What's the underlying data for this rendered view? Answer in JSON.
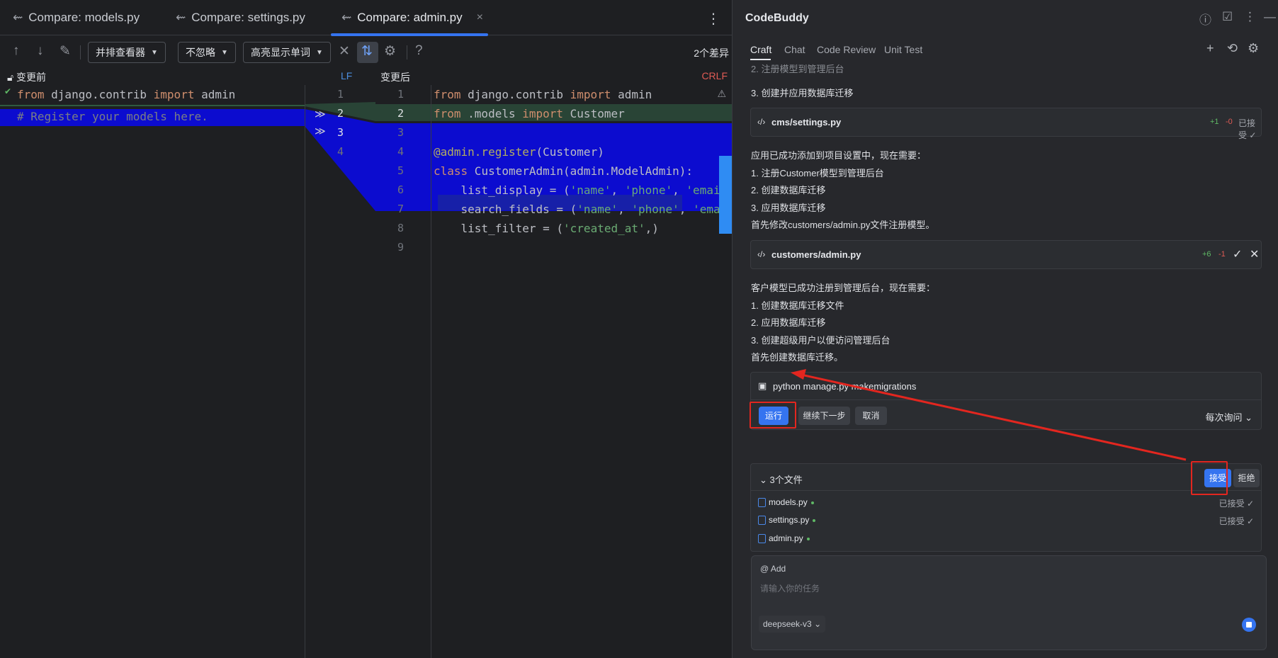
{
  "editor": {
    "tabs": [
      {
        "label": "Compare: models.py"
      },
      {
        "label": "Compare: settings.py"
      },
      {
        "label": "Compare: admin.py",
        "close": "×"
      }
    ],
    "more_label": "⋮",
    "toolbar": {
      "viewer_mode": "并排查看器",
      "ignore_mode": "不忽略",
      "highlight_mode": "高亮显示单词",
      "help_label": "?",
      "diff_count": "2个差异"
    },
    "before_label": "变更前",
    "before_eol": "LF",
    "after_label": "变更后",
    "after_eol": "CRLF",
    "left_lines": [
      {
        "num": "1",
        "tokens": [
          [
            "kw",
            "from"
          ],
          [
            "id",
            " django.contrib "
          ],
          [
            "kw",
            "import"
          ],
          [
            "id",
            " admin"
          ]
        ]
      },
      {
        "num": "2",
        "tokens": []
      },
      {
        "num": "3",
        "tokens": [
          [
            "com",
            "# Register your models here."
          ]
        ]
      },
      {
        "num": "4",
        "tokens": []
      }
    ],
    "right_lines": [
      {
        "num": "1",
        "tokens": [
          [
            "kw",
            "from"
          ],
          [
            "id",
            " django.contrib "
          ],
          [
            "kw",
            "import"
          ],
          [
            "id",
            " admin"
          ]
        ]
      },
      {
        "num": "2",
        "tokens": [
          [
            "kw",
            "from"
          ],
          [
            "id",
            " .models "
          ],
          [
            "kw",
            "import"
          ],
          [
            "id",
            " Customer"
          ]
        ]
      },
      {
        "num": "3",
        "tokens": []
      },
      {
        "num": "4",
        "tokens": [
          [
            "dec",
            "@admin.register"
          ],
          [
            "id",
            "(Customer)"
          ]
        ]
      },
      {
        "num": "5",
        "tokens": [
          [
            "kw",
            "class"
          ],
          [
            "id",
            " CustomerAdmin(admin.ModelAdmin):"
          ]
        ]
      },
      {
        "num": "6",
        "tokens": [
          [
            "id",
            "    list_display = ("
          ],
          [
            "str",
            "'name'"
          ],
          [
            "id",
            ", "
          ],
          [
            "str",
            "'phone'"
          ],
          [
            "id",
            ", "
          ],
          [
            "str",
            "'email'"
          ]
        ]
      },
      {
        "num": "7",
        "tokens": [
          [
            "id",
            "    search_fields = ("
          ],
          [
            "str",
            "'name'"
          ],
          [
            "id",
            ", "
          ],
          [
            "str",
            "'phone'"
          ],
          [
            "id",
            ", "
          ],
          [
            "str",
            "'email'"
          ]
        ]
      },
      {
        "num": "8",
        "tokens": [
          [
            "id",
            "    list_filter = ("
          ],
          [
            "str",
            "'created_at'"
          ],
          [
            "id",
            ",)"
          ]
        ]
      },
      {
        "num": "9",
        "tokens": []
      }
    ]
  },
  "codebuddy": {
    "title": "CodeBuddy",
    "tabs": [
      "Craft",
      "Chat",
      "Code Review",
      "Unit Test"
    ],
    "truncated_line": "2. 注册模型到管理后台",
    "msg1_last": "3. 创建并应用数据库迁移",
    "card1": {
      "name": "cms/settings.py",
      "added": "+1",
      "removed": "-0",
      "status": "已接受"
    },
    "msg2": [
      "应用已成功添加到项目设置中，现在需要：",
      "1. 注册Customer模型到管理后台",
      "2. 创建数据库迁移",
      "3. 应用数据库迁移",
      "首先修改customers/admin.py文件注册模型。"
    ],
    "card2": {
      "name": "customers/admin.py",
      "added": "+6",
      "removed": "-1"
    },
    "msg3": [
      "客户模型已成功注册到管理后台，现在需要：",
      "1. 创建数据库迁移文件",
      "2. 应用数据库迁移",
      "3. 创建超级用户以便访问管理后台",
      "首先创建数据库迁移。"
    ],
    "command": {
      "text": "python manage.py makemigrations",
      "run_label": "运行",
      "continue_label": "继续下一步",
      "cancel_label": "取消",
      "ask_mode": "每次询问"
    },
    "files": {
      "title": "3个文件",
      "accept_label": "接受",
      "reject_label": "拒绝",
      "items": [
        {
          "name": "models.py",
          "status": "已接受"
        },
        {
          "name": "settings.py",
          "status": "已接受"
        },
        {
          "name": "admin.py",
          "status": ""
        }
      ]
    },
    "input": {
      "at_add": "@ Add",
      "placeholder": "请输入你的任务",
      "model": "deepseek-v3"
    },
    "colors": {
      "accent": "#3574f0",
      "annotation": "#e3261f",
      "added": "#5fb865",
      "removed": "#e05b55"
    }
  }
}
